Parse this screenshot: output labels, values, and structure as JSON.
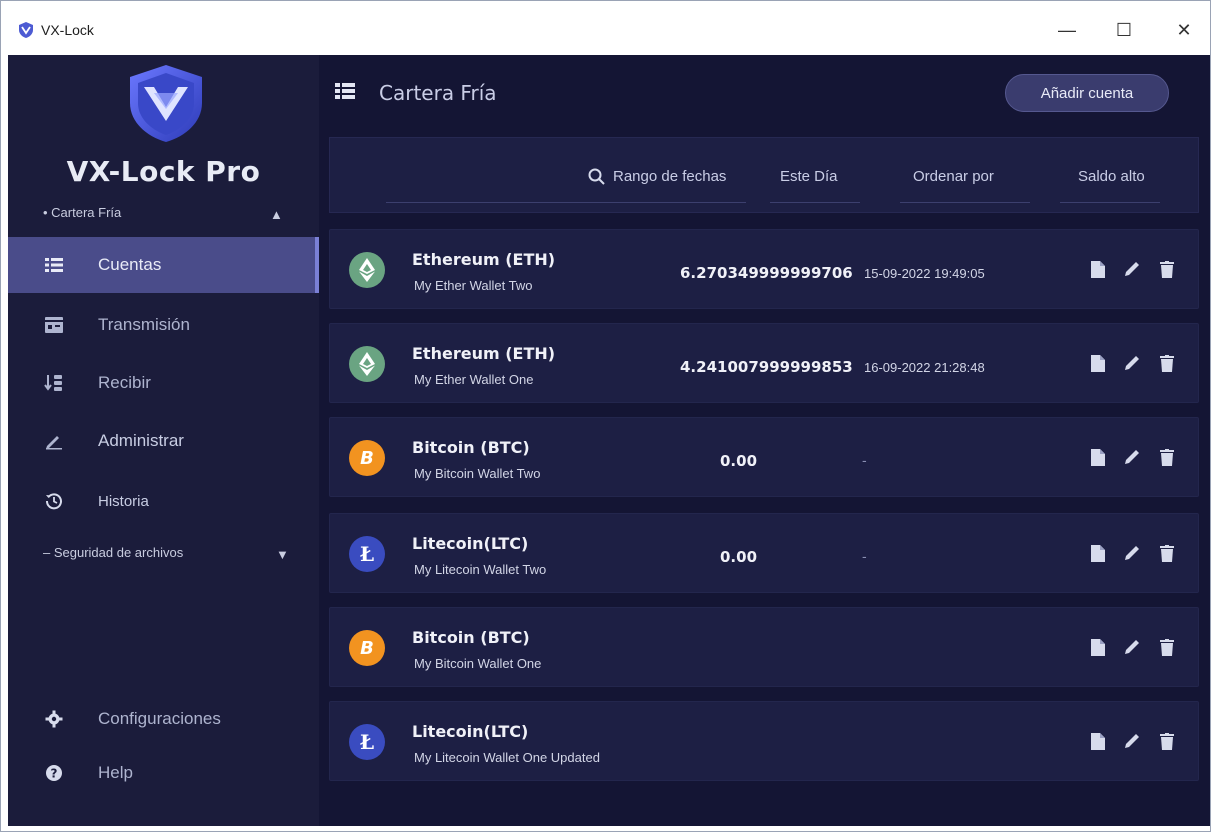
{
  "window": {
    "title": "VX-Lock",
    "minimize": "—",
    "maximize": "☐",
    "close": "✕"
  },
  "sidebar": {
    "brand": "VX-Lock Pro",
    "section_cold_wallet": "• Cartera Fría",
    "section_file_security": "– Seguridad de archivos",
    "items": [
      {
        "label": "Cuentas",
        "icon": "list-icon",
        "active": true
      },
      {
        "label": "Transmisión",
        "icon": "transmit-icon",
        "active": false
      },
      {
        "label": "Recibir",
        "icon": "receive-icon",
        "active": false
      },
      {
        "label": "Administrar",
        "icon": "pencil-icon",
        "active": false
      },
      {
        "label": "Historia",
        "icon": "history-icon",
        "active": false
      }
    ],
    "bottom_items": [
      {
        "label": "Configuraciones",
        "icon": "gear-icon"
      },
      {
        "label": "Help",
        "icon": "help-icon"
      }
    ]
  },
  "header": {
    "title": "Cartera Fría",
    "add_button": "Añadir cuenta"
  },
  "filters": {
    "date_range": "Rango de fechas",
    "period": "Este Día",
    "sort_label": "Ordenar por",
    "sort_value": "Saldo alto"
  },
  "accounts": [
    {
      "name": "Ethereum (ETH)",
      "wallet": "My Ether Wallet Two",
      "balance": "6.270349999999706",
      "date": "15-09-2022 19:49:05",
      "coin": "eth"
    },
    {
      "name": "Ethereum (ETH)",
      "wallet": "My Ether Wallet One",
      "balance": "4.241007999999853",
      "date": "16-09-2022 21:28:48",
      "coin": "eth"
    },
    {
      "name": "Bitcoin (BTC)",
      "wallet": "My Bitcoin Wallet Two",
      "balance": "0.00",
      "date": "-",
      "coin": "btc"
    },
    {
      "name": "Litecoin(LTC)",
      "wallet": "My Litecoin Wallet Two",
      "balance": "0.00",
      "date": "-",
      "coin": "ltc"
    },
    {
      "name": "Bitcoin (BTC)",
      "wallet": "My Bitcoin Wallet One",
      "balance": "",
      "date": "",
      "coin": "btc"
    },
    {
      "name": "Litecoin(LTC)",
      "wallet": "My Litecoin Wallet One Updated",
      "balance": "",
      "date": "",
      "coin": "ltc"
    }
  ],
  "coin_glyphs": {
    "btc": "B",
    "ltc": "Ł"
  },
  "colors": {
    "sidebar_bg": "#1b1c3b",
    "main_bg": "#141534",
    "card_bg": "#1d1f44",
    "active_item": "#4a4c8a",
    "btc": "#f29320",
    "eth": "#6aa482",
    "ltc": "#3a4cc0"
  }
}
